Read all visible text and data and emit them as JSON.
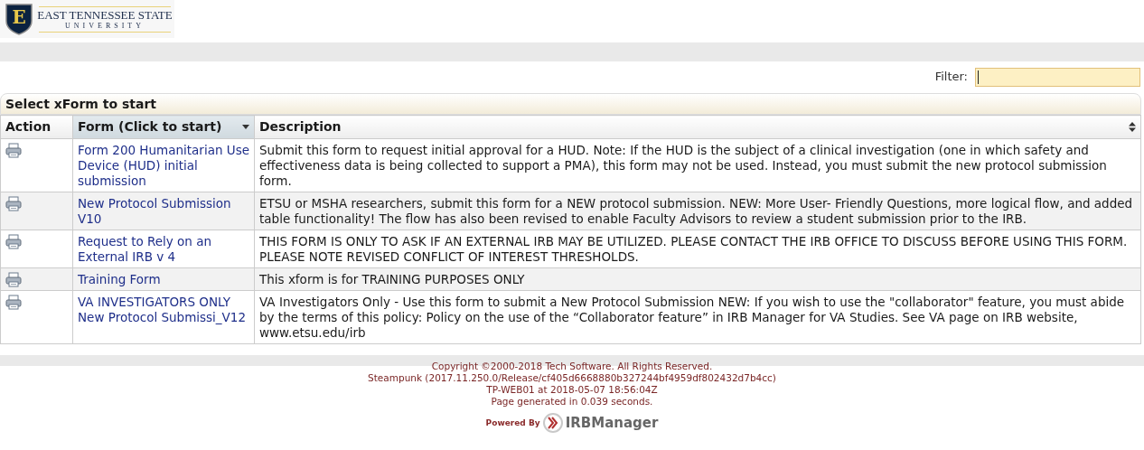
{
  "logo": {
    "mark": "E",
    "line_1": "EAST TENNESSEE STATE",
    "line_2": "UNIVERSITY"
  },
  "filter": {
    "label": "Filter:"
  },
  "table": {
    "caption": "Select xForm to start",
    "columns": [
      {
        "label": "Action",
        "sortable": false,
        "sorted": false
      },
      {
        "label": "Form (Click to start)",
        "sortable": true,
        "sorted": true
      },
      {
        "label": "Description",
        "sortable": true,
        "sorted": false
      }
    ],
    "rows": [
      {
        "form": "Form 200 Humanitarian Use Device (HUD) initial submission",
        "description": "Submit this form to request initial approval for a HUD. Note: If the HUD is the subject of a clinical investigation (one in which safety and effectiveness data is being collected to support a PMA), this form may not be used. Instead, you must submit the new protocol submission form."
      },
      {
        "form": "New Protocol Submission V10",
        "description": "ETSU or MSHA researchers, submit this form for a NEW protocol submission. NEW: More User- Friendly Questions, more logical flow, and added table functionality! The flow has also been revised to enable Faculty Advisors to review a student submission prior to the IRB."
      },
      {
        "form": "Request to Rely on an External IRB v 4",
        "description": "THIS FORM IS ONLY TO ASK IF AN EXTERNAL IRB MAY BE UTILIZED. PLEASE CONTACT THE IRB OFFICE TO DISCUSS BEFORE USING THIS FORM. PLEASE NOTE REVISED CONFLICT OF INTEREST THRESHOLDS."
      },
      {
        "form": "Training Form",
        "description": "This xform is for TRAINING PURPOSES ONLY"
      },
      {
        "form": "VA INVESTIGATORS ONLY New Protocol Submissi_V12",
        "description": "VA Investigators Only - Use this form to submit a New Protocol Submission NEW: If you wish to use the \"collaborator\" feature, you must abide by the terms of this policy: Policy on the use of the “Collaborator feature” in IRB Manager for VA Studies. See VA page on IRB website, www.etsu.edu/irb"
      }
    ]
  },
  "footer": {
    "lines": [
      "Copyright ©2000-2018 Tech Software. All Rights Reserved.",
      "Steampunk (2017.11.250.0/Release/cf405d6668880b327244bf4959df802432d7b4cc)",
      "TP-WEB01 at 2018-05-07 18:56:04Z",
      "Page generated in 0.039 seconds."
    ],
    "powered_by": "Powered By",
    "product": "IRBManager"
  }
}
